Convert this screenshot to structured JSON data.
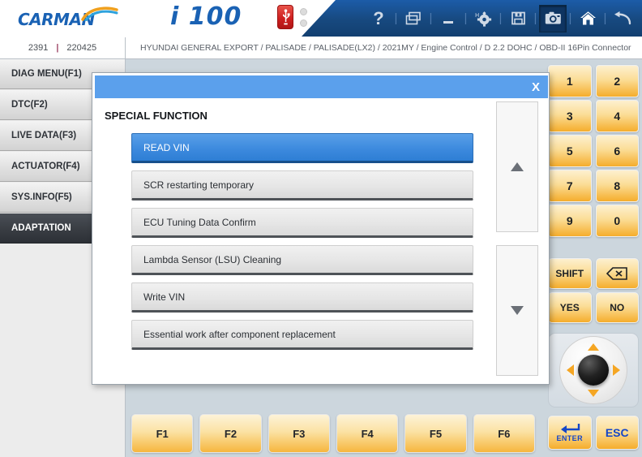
{
  "header": {
    "logo_text": "CARMAN",
    "brand": "i 100",
    "usb_icon": "usb-icon",
    "tools": [
      {
        "name": "help-icon",
        "glyph": "?",
        "pressed": false
      },
      {
        "name": "window-icon",
        "glyph": "window",
        "pressed": false
      },
      {
        "name": "minimize-icon",
        "glyph": "minimize",
        "pressed": false
      },
      {
        "name": "settings-icon",
        "glyph": "gear",
        "pressed": false
      },
      {
        "name": "save-icon",
        "glyph": "floppy",
        "pressed": false
      },
      {
        "name": "screenshot-icon",
        "glyph": "camera",
        "pressed": true
      },
      {
        "name": "home-icon",
        "glyph": "home",
        "pressed": false
      },
      {
        "name": "back-icon",
        "glyph": "back-arrow",
        "pressed": false
      }
    ]
  },
  "breadcrumb": {
    "text": "HYUNDAI GENERAL EXPORT / PALISADE / PALISADE(LX2) / 2021MY / Engine Control / D 2.2 DOHC / OBD-II 16Pin Connector"
  },
  "sidebar": {
    "status_left": "2391",
    "status_sep": "|",
    "status_right": "220425",
    "items": [
      {
        "label": "DIAG MENU(F1)",
        "active": false
      },
      {
        "label": "DTC(F2)",
        "active": false
      },
      {
        "label": "LIVE DATA(F3)",
        "active": false
      },
      {
        "label": "ACTUATOR(F4)",
        "active": false
      },
      {
        "label": "SYS.INFO(F5)",
        "active": false
      },
      {
        "label": "ADAPTATION",
        "active": true
      }
    ]
  },
  "dialog": {
    "close_label": "X",
    "heading": "SPECIAL FUNCTION",
    "items": [
      {
        "label": "READ VIN",
        "selected": true
      },
      {
        "label": "SCR restarting temporary",
        "selected": false
      },
      {
        "label": "ECU Tuning Data Confirm",
        "selected": false
      },
      {
        "label": "Lambda Sensor (LSU) Cleaning",
        "selected": false
      },
      {
        "label": "Write VIN",
        "selected": false
      },
      {
        "label": "Essential work after component replacement",
        "selected": false
      }
    ],
    "scroll_up": "scroll-up-icon",
    "scroll_down": "scroll-down-icon"
  },
  "function_keys": [
    "F1",
    "F2",
    "F3",
    "F4",
    "F5",
    "F6"
  ],
  "keypad": {
    "numbers": [
      "1",
      "2",
      "3",
      "4",
      "5",
      "6",
      "7",
      "8",
      "9",
      "0"
    ],
    "shift": "SHIFT",
    "backspace": "backspace-icon",
    "yes": "YES",
    "no": "NO"
  },
  "dpad": {
    "up": "dpad-up-icon",
    "down": "dpad-down-icon",
    "left": "dpad-left-icon",
    "right": "dpad-right-icon",
    "center": "dpad-center-knob"
  },
  "action_keys": {
    "enter": "ENTER",
    "esc": "ESC"
  },
  "colors": {
    "brand_blue": "#1a62b4",
    "header_blue": "#17497f",
    "dialog_title_blue": "#5ba0ec",
    "selected_blue": "#3d8ade",
    "key_yellow": "#f5ad2c",
    "usb_red": "#cf2020",
    "content_bg": "#ccd6dd"
  }
}
